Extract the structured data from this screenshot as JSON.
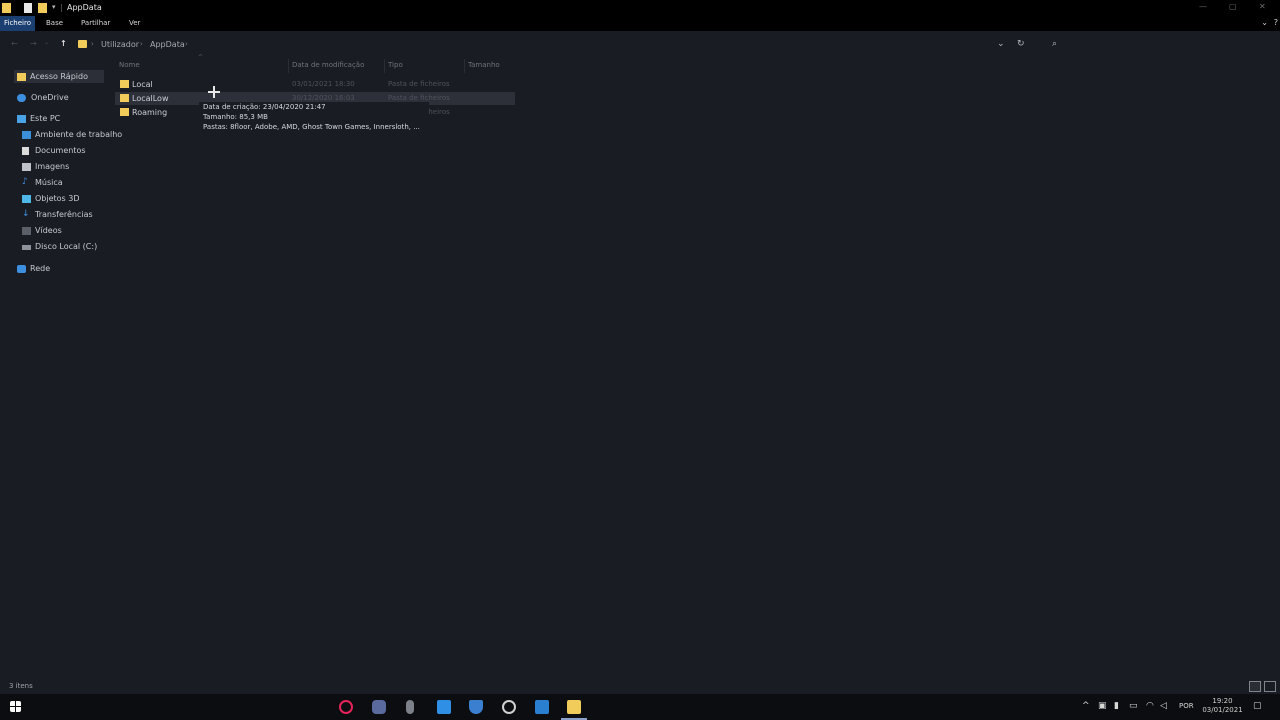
{
  "window": {
    "title": "AppData",
    "tabs": [
      {
        "label": "Ficheiro",
        "active": true
      },
      {
        "label": "Base",
        "active": false
      },
      {
        "label": "Partilhar",
        "active": false
      },
      {
        "label": "Ver",
        "active": false
      }
    ]
  },
  "address": {
    "crumbs": [
      "Utilizador",
      "AppData"
    ]
  },
  "navpane": {
    "items": [
      {
        "label": "Acesso Rápido",
        "icon": "star-folder-icon"
      },
      {
        "label": "OneDrive",
        "icon": "cloud-icon"
      },
      {
        "label": "Este PC",
        "icon": "computer-icon"
      },
      {
        "label": "Ambiente de trabalho",
        "icon": "desktop-icon"
      },
      {
        "label": "Documentos",
        "icon": "document-icon"
      },
      {
        "label": "Imagens",
        "icon": "image-icon"
      },
      {
        "label": "Música",
        "icon": "music-icon"
      },
      {
        "label": "Objetos 3D",
        "icon": "cube-icon"
      },
      {
        "label": "Transferências",
        "icon": "download-icon"
      },
      {
        "label": "Vídeos",
        "icon": "video-icon"
      },
      {
        "label": "Disco Local (C:)",
        "icon": "drive-icon"
      },
      {
        "label": "Rede",
        "icon": "network-icon"
      }
    ]
  },
  "columns": {
    "name": "Nome",
    "date": "Data de modificação",
    "type": "Tipo",
    "size": "Tamanho"
  },
  "files": [
    {
      "name": "Local",
      "date": "03/01/2021 18:30",
      "type": "Pasta de ficheiros"
    },
    {
      "name": "LocalLow",
      "date": "30/12/2020 16:03",
      "type": "Pasta de ficheiros"
    },
    {
      "name": "Roaming",
      "date": "",
      "type": "Pasta de ficheiros"
    }
  ],
  "tooltip": {
    "line1": "Data de criação: 23/04/2020 21:47",
    "line2": "Tamanho: 85,3 MB",
    "line3": "Pastas: 8floor, Adobe, AMD, Ghost Town Games, Innersloth, ..."
  },
  "status": {
    "count": "3 itens"
  },
  "taskbar": {
    "lang": "POR",
    "time": "19:20",
    "date": "03/01/2021"
  },
  "colors": {
    "folder": "#f1cc5a",
    "accent": "#1c3f72"
  }
}
